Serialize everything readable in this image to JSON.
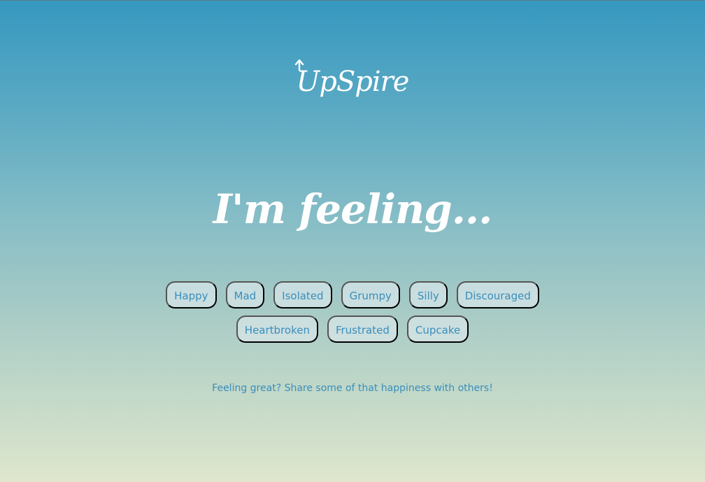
{
  "brand": {
    "name": "UpSpire",
    "icon": "up-arrow-icon",
    "text_color": "#ffffff"
  },
  "main": {
    "heading": "I'm feeling..."
  },
  "moods": [
    {
      "label": "Happy"
    },
    {
      "label": "Mad"
    },
    {
      "label": "Isolated"
    },
    {
      "label": "Grumpy"
    },
    {
      "label": "Silly"
    },
    {
      "label": "Discouraged"
    },
    {
      "label": "Heartbroken"
    },
    {
      "label": "Frustrated"
    },
    {
      "label": "Cupcake"
    }
  ],
  "footer": {
    "share_link": "Feeling great? Share some of that happiness with others!"
  },
  "colors": {
    "gradient_top": "#3698c0",
    "gradient_bottom": "#dfe6cd",
    "chip_background": "#dce8ea",
    "chip_text": "#3a8ebb"
  }
}
